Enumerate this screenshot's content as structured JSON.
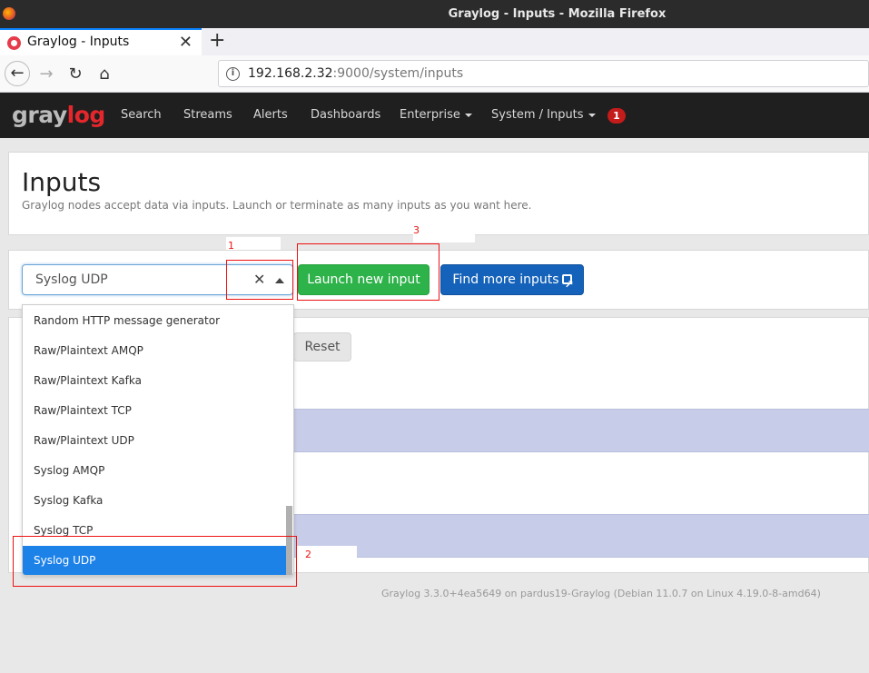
{
  "window": {
    "title": "Graylog - Inputs - Mozilla Firefox"
  },
  "browser": {
    "tab_title": "Graylog - Inputs",
    "tab_close": "✕",
    "new_tab": "+",
    "url_host": "192.168.2.32",
    "url_rest": ":9000/system/inputs"
  },
  "graylog": {
    "logo_a": "gray",
    "logo_b": "log",
    "nav": [
      "Search",
      "Streams",
      "Alerts",
      "Dashboards"
    ],
    "nav_enterprise": "Enterprise",
    "nav_system": "System / Inputs",
    "notification_count": "1"
  },
  "page": {
    "title": "Inputs",
    "description": "Graylog nodes accept data via inputs. Launch or terminate as many inputs as you want here."
  },
  "input_select": {
    "value": "Syslog UDP",
    "clear": "✕",
    "options": [
      "Random HTTP message generator",
      "Raw/Plaintext AMQP",
      "Raw/Plaintext Kafka",
      "Raw/Plaintext TCP",
      "Raw/Plaintext UDP",
      "Syslog AMQP",
      "Syslog Kafka",
      "Syslog TCP",
      "Syslog UDP"
    ],
    "selected_option": "Syslog UDP"
  },
  "buttons": {
    "launch": "Launch new input",
    "find": "Find more inputs",
    "reset": "Reset"
  },
  "annotations": {
    "a1": "1",
    "a2": "2",
    "a3": "3"
  },
  "footer": "Graylog 3.3.0+4ea5649 on pardus19-Graylog (Debian 11.0.7 on Linux 4.19.0-8-amd64)",
  "colors": {
    "launch_button": "#2eb24a",
    "find_button": "#1462b9",
    "selected_option": "#1d82e8",
    "annotation": "#ee1111",
    "header": "#1f1f1f"
  }
}
